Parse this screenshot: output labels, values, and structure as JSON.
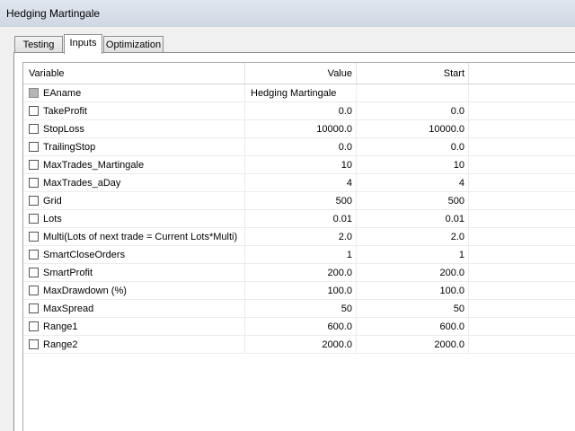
{
  "window": {
    "title": "Hedging Martingale"
  },
  "tabs": [
    {
      "label": "Testing"
    },
    {
      "label": "Inputs"
    },
    {
      "label": "Optimization"
    }
  ],
  "active_tab": "Inputs",
  "grid": {
    "headers": {
      "variable": "Variable",
      "value": "Value",
      "start": "Start"
    },
    "rows": [
      {
        "name": "EAname",
        "value": "Hedging Martingale",
        "start": "",
        "checked": false,
        "disabled": true
      },
      {
        "name": "TakeProfit",
        "value": "0.0",
        "start": "0.0",
        "checked": false
      },
      {
        "name": "StopLoss",
        "value": "10000.0",
        "start": "10000.0",
        "checked": false
      },
      {
        "name": "TrailingStop",
        "value": "0.0",
        "start": "0.0",
        "checked": false
      },
      {
        "name": "MaxTrades_Martingale",
        "value": "10",
        "start": "10",
        "checked": false
      },
      {
        "name": "MaxTrades_aDay",
        "value": "4",
        "start": "4",
        "checked": false
      },
      {
        "name": "Grid",
        "value": "500",
        "start": "500",
        "checked": false
      },
      {
        "name": "Lots",
        "value": "0.01",
        "start": "0.01",
        "checked": false
      },
      {
        "name": "Multi(Lots of next trade = Current Lots*Multi)",
        "value": "2.0",
        "start": "2.0",
        "checked": false
      },
      {
        "name": "SmartCloseOrders",
        "value": "1",
        "start": "1",
        "checked": false
      },
      {
        "name": "SmartProfit",
        "value": "200.0",
        "start": "200.0",
        "checked": false
      },
      {
        "name": "MaxDrawdown (%)",
        "value": "100.0",
        "start": "100.0",
        "checked": false
      },
      {
        "name": "MaxSpread",
        "value": "50",
        "start": "50",
        "checked": false
      },
      {
        "name": "Range1",
        "value": "600.0",
        "start": "600.0",
        "checked": false
      },
      {
        "name": "Range2",
        "value": "2000.0",
        "start": "2000.0",
        "checked": false
      }
    ]
  }
}
